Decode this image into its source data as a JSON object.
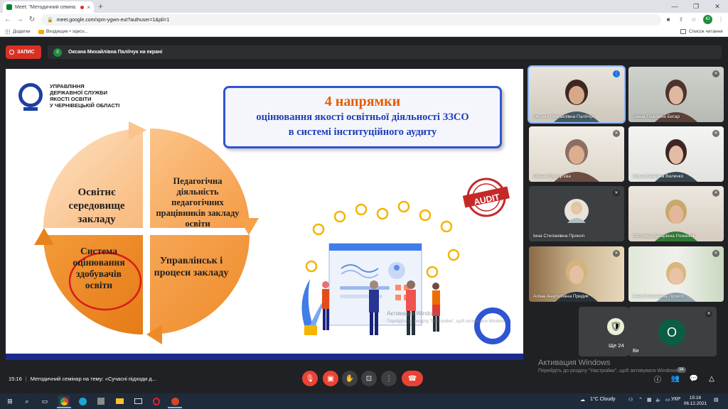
{
  "browser": {
    "tab_title": "Meet: \"Методичний семіна",
    "tab_close": "×",
    "new_tab": "+",
    "url": "meet.google.com/xpm-ygwn-eut?authuser=1&pli=1",
    "profile_initials": "Ю",
    "bookmarks": {
      "apps": "Додатки",
      "folder": "Входящие • sqecv...",
      "reading_list": "Список читання"
    }
  },
  "meet": {
    "record_label": "ЗАПИС",
    "presenter_count": "0",
    "presenting_text": "Оксана Михайлівна Паліїчук на екрані",
    "time": "15:16",
    "meeting_title": "Методичний семінар на тему: «Сучасні підходи д...",
    "more_count_label": "Ще 24",
    "you_initial": "О",
    "you_label": "Ви",
    "participants_badge": "34"
  },
  "slide": {
    "org": [
      "УПРАВЛІННЯ",
      "ДЕРЖАВНОЇ СЛУЖБИ",
      "ЯКОСТІ ОСВІТИ",
      "У ЧЕРНІВЕЦЬКІЙ ОБЛАСТІ"
    ],
    "title_1": "4 напрямки",
    "title_2": "оцінювання якості освітньої діяльності ЗЗСО",
    "title_3": "в системі інституційного аудиту",
    "q1": "Освітнє середовище закладу",
    "q2": "Педагогічна діяльність педагогічних працівників закладу освіти",
    "q3": "Система оцінювання здобувачів освіти",
    "q4": "Управлінськ і процеси закладу",
    "stamp_text": "AUDIT",
    "wm_line1": "Активация Windows",
    "wm_line2": "Перейдіть до розділу \"Настройки\", щоб активувати Windows."
  },
  "participants": [
    {
      "name": "Оксана Михайлівна Паліїчук",
      "muted": false
    },
    {
      "name": "Ганна Павлівна Бигар",
      "muted": true
    },
    {
      "name": "Олена Григор'єва",
      "muted": true
    },
    {
      "name": "Ольга Іванівна Величко",
      "muted": true
    },
    {
      "name": "Інна Степанівна Прокоп",
      "muted": true
    },
    {
      "name": "Світлана Захарівна Романюк",
      "muted": true
    },
    {
      "name": "Аліна Анатоліївна Предик",
      "muted": true
    },
    {
      "name": "Інна Степанівна Прокоп",
      "muted": true
    }
  ],
  "windows_watermark": {
    "line1": "Активация Windows",
    "line2": "Перейдіть до розділу \"Настройки\", щоб активувати Windows."
  },
  "taskbar": {
    "weather": "1°C  Cloudy",
    "language": "УКР",
    "time": "15:16",
    "date": "06.12.2021"
  },
  "colors": {
    "accent_red": "#ea4335",
    "meet_bg": "#202124",
    "slide_blue": "#1f3db8",
    "slide_orange": "#e65c00"
  }
}
